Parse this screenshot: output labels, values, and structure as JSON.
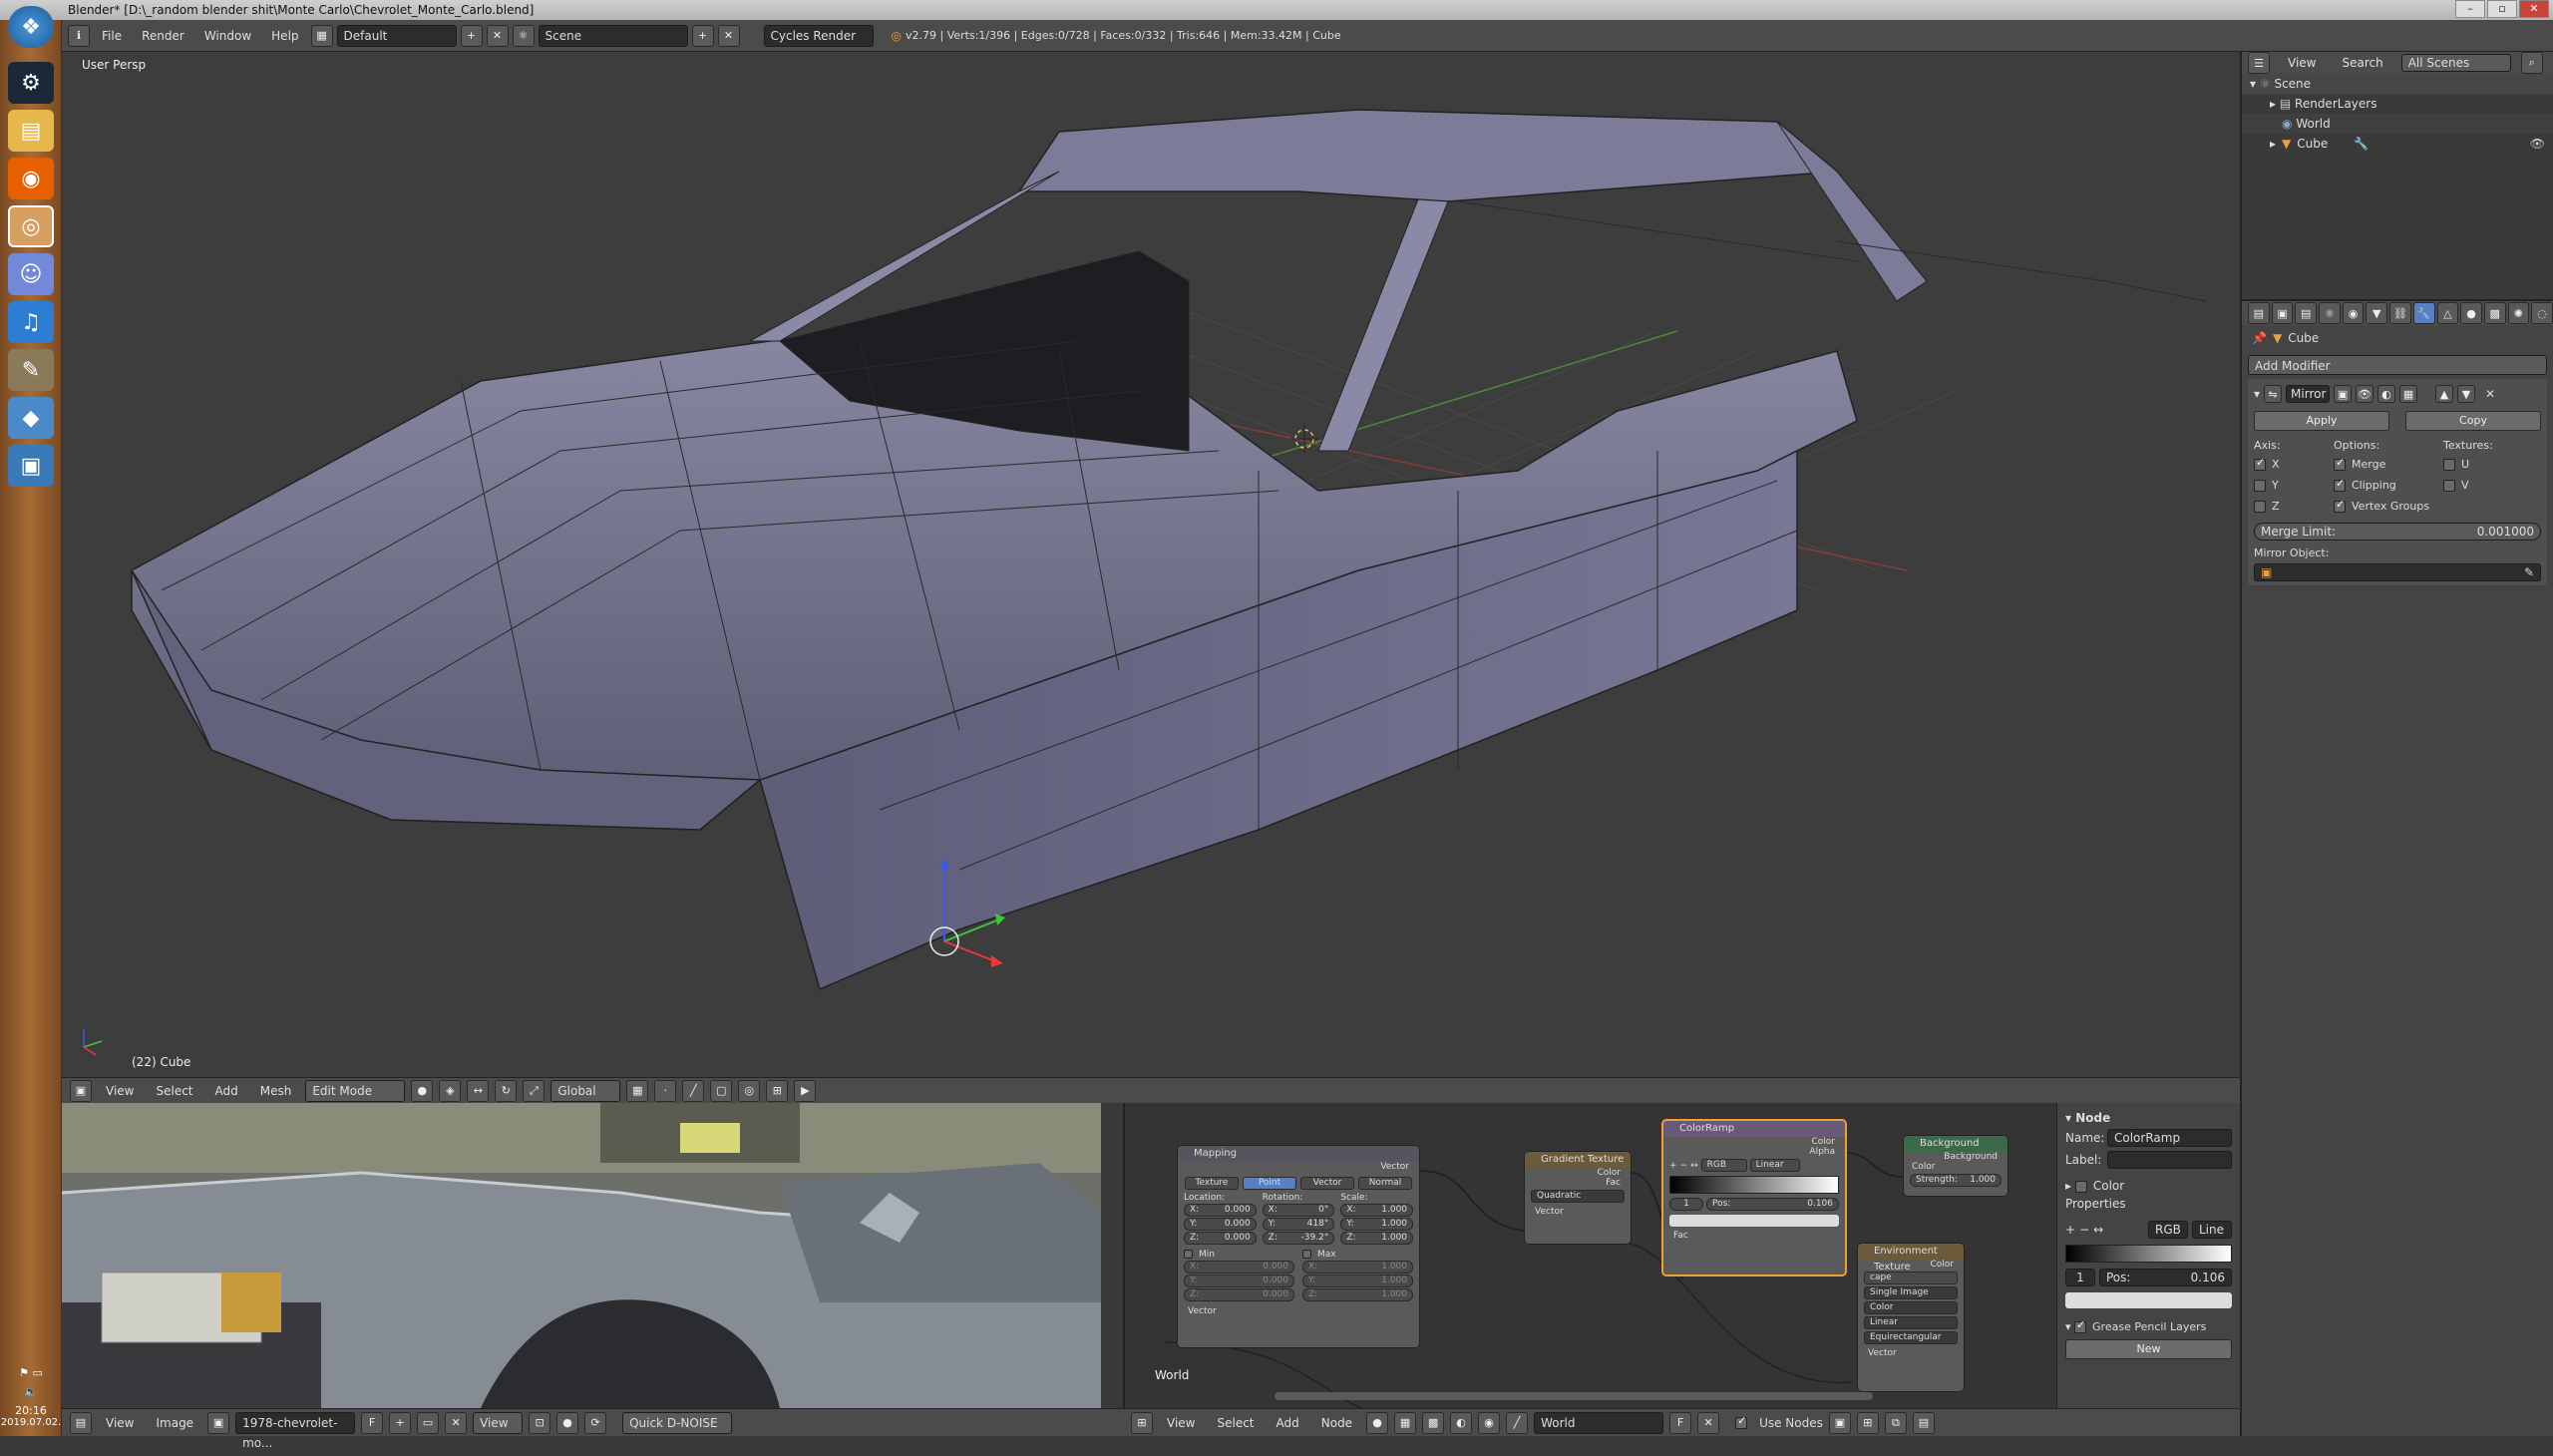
{
  "title_bar": {
    "text": "Blender* [D:\\_random blender shit\\Monte Carlo\\Chevrolet_Monte_Carlo.blend]",
    "controls": [
      "–",
      "▫",
      "✕"
    ]
  },
  "taskbar": {
    "icons": [
      "windows-orb-icon",
      "steam-icon",
      "file-explorer-icon",
      "firefox-icon",
      "blender-icon",
      "discord-icon",
      "headphones-icon",
      "gimp-icon",
      "diamond-app-icon",
      "settings-app-icon"
    ],
    "time": "20:16",
    "date": "2019.07.02."
  },
  "info_header": {
    "menus": [
      "File",
      "Render",
      "Window",
      "Help"
    ],
    "layout": "Default",
    "scene": "Scene",
    "engine": "Cycles Render",
    "stats": "v2.79 | Verts:1/396 | Edges:0/728 | Faces:0/332 | Tris:646 | Mem:33.42M | Cube"
  },
  "viewport": {
    "view_label": "User Persp",
    "object_label": "(22) Cube"
  },
  "v3d_header": {
    "menus": [
      "View",
      "Select",
      "Add",
      "Mesh"
    ],
    "mode": "Edit Mode",
    "orientation": "Global"
  },
  "image_header": {
    "menus": [
      "View",
      "Image"
    ],
    "image_name": "1978-chevrolet-mo...",
    "view": "View",
    "denoise": "Quick D-NOISE"
  },
  "node_header": {
    "menus": [
      "View",
      "Select",
      "Add",
      "Node"
    ],
    "world": "World",
    "use_nodes": "Use Nodes",
    "editor_label": "World"
  },
  "nodes": {
    "mapping": {
      "title": "Mapping",
      "out_vector": "Vector",
      "tabs": [
        "Texture",
        "Point",
        "Vector",
        "Normal"
      ],
      "location_label": "Location:",
      "rotation_label": "Rotation:",
      "scale_label": "Scale:",
      "loc": [
        "X:",
        "0.000",
        "Y:",
        "0.000",
        "Z:",
        "0.000"
      ],
      "rot": [
        "X:",
        "0°",
        "Y:",
        "418°",
        "Z:",
        "-39.2°"
      ],
      "scale": [
        "X:",
        "1.000",
        "Y:",
        "1.000",
        "Z:",
        "1.000"
      ],
      "min": "Min",
      "max": "Max",
      "min_vals": [
        "X:",
        "0.000",
        "Y:",
        "0.000",
        "Z:",
        "0.000"
      ],
      "max_vals": [
        "X:",
        "1.000",
        "Y:",
        "1.000",
        "Z:",
        "1.000"
      ],
      "in_vector": "Vector"
    },
    "gradient": {
      "title": "Gradient Texture",
      "color": "Color",
      "fac": "Fac",
      "type": "Quadratic",
      "vector": "Vector"
    },
    "colorramp": {
      "title": "ColorRamp",
      "color": "Color",
      "alpha": "Alpha",
      "mode": "RGB",
      "interp": "Linear",
      "index": "1",
      "pos": "Pos:",
      "pos_val": "0.106",
      "fac": "Fac"
    },
    "background": {
      "title": "Background",
      "out": "Background",
      "color": "Color",
      "strength": "Strength:",
      "strength_val": "1.000"
    },
    "env": {
      "title": "Environment Texture",
      "color": "Color",
      "image": "cape",
      "source": "Single Image",
      "colorspace": "Color",
      "interp": "Linear",
      "proj": "Equirectangular",
      "vector": "Vector"
    }
  },
  "node_props": {
    "node_section": "Node",
    "name_label": "Name:",
    "name_val": "ColorRamp",
    "label_label": "Label:",
    "color_section": "Color",
    "properties_section": "Properties",
    "mode": "RGB",
    "interp": "Line",
    "index": "1",
    "pos_label": "Pos:",
    "pos_val": "0.106",
    "grease": "Grease Pencil Layers",
    "new": "New"
  },
  "outliner": {
    "menus": [
      "View",
      "Search"
    ],
    "filter": "All Scenes",
    "items": [
      "Scene",
      "RenderLayers",
      "World",
      "Cube"
    ]
  },
  "properties": {
    "object": "Cube",
    "add_modifier": "Add Modifier",
    "modifier_name": "Mirror",
    "apply": "Apply",
    "copy": "Copy",
    "axis_label": "Axis:",
    "options_label": "Options:",
    "textures_label": "Textures:",
    "axes": [
      "X",
      "Y",
      "Z"
    ],
    "options": [
      "Merge",
      "Clipping",
      "Vertex Groups"
    ],
    "textures": [
      "U",
      "V"
    ],
    "merge_limit_label": "Merge Limit:",
    "merge_limit_val": "0.001000",
    "mirror_object_label": "Mirror Object:"
  }
}
